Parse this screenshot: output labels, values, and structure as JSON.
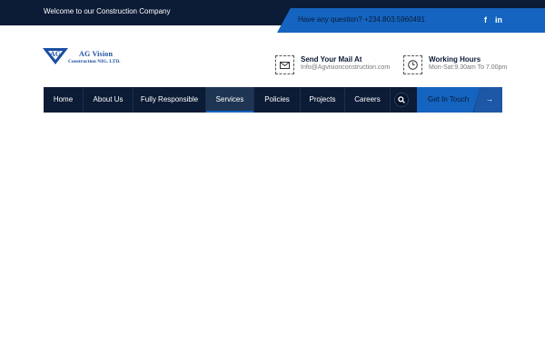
{
  "topbar": {
    "welcome": "Welcome to our Construction Company",
    "question": "Have any question? +234.803.5960491",
    "social": [
      {
        "icon": "facebook-icon",
        "label": "f"
      },
      {
        "icon": "linkedin-icon",
        "label": "in"
      }
    ]
  },
  "logo": {
    "initials": "AG",
    "name": "AG Vision",
    "subtitle": "Construction NIG. LTD."
  },
  "contact": {
    "mail_title": "Send Your Mail At",
    "mail_value": "Info@Agvisionconstruction.com",
    "hours_title": "Working Hours",
    "hours_value": "Mon-Sat:9.30am To 7.00pm"
  },
  "nav": {
    "items": [
      "Home",
      "About Us",
      "Fully Responsible",
      "Services",
      "Policies",
      "Projects",
      "Careers"
    ],
    "active": "Services",
    "cta": "Get In Touch",
    "arrow": "→"
  },
  "colors": {
    "navy": "#0c1b36",
    "accent_blue": "#1464c0"
  }
}
